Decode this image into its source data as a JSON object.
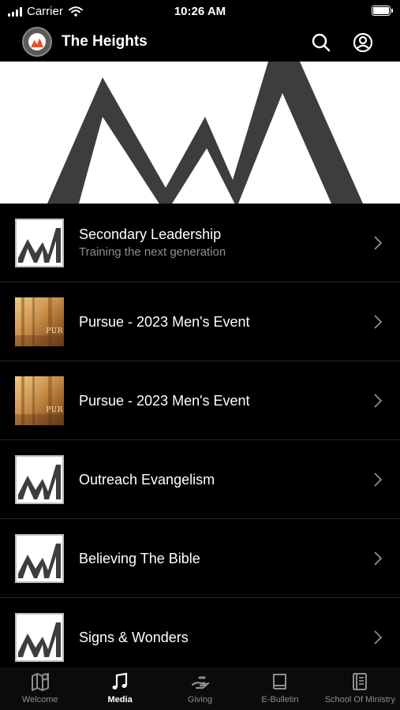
{
  "status_bar": {
    "carrier": "Carrier",
    "time": "10:26 AM"
  },
  "nav": {
    "title": "The Heights"
  },
  "list": {
    "items": [
      {
        "title": "Secondary Leadership",
        "subtitle": "Training the next generation",
        "thumbnail": "heights-logo"
      },
      {
        "title": "Pursue - 2023 Men's Event",
        "subtitle": "",
        "thumbnail": "pursue-photo",
        "thumb_text": "PUR"
      },
      {
        "title": "Pursue - 2023 Men's Event",
        "subtitle": "",
        "thumbnail": "pursue-photo",
        "thumb_text": "PUR"
      },
      {
        "title": "Outreach Evangelism",
        "subtitle": "",
        "thumbnail": "heights-logo"
      },
      {
        "title": "Believing The Bible",
        "subtitle": "",
        "thumbnail": "heights-logo"
      },
      {
        "title": "Signs & Wonders",
        "subtitle": "",
        "thumbnail": "heights-logo"
      }
    ]
  },
  "tabs": [
    {
      "label": "Welcome",
      "icon": "map-pin-icon",
      "active": false
    },
    {
      "label": "Media",
      "icon": "music-note-icon",
      "active": true
    },
    {
      "label": "Giving",
      "icon": "giving-hand-icon",
      "active": false
    },
    {
      "label": "E-Bulletin",
      "icon": "book-icon",
      "active": false
    },
    {
      "label": "School Of Ministry",
      "icon": "notebook-icon",
      "active": false
    }
  ],
  "colors": {
    "background": "#000000",
    "active_tab": "#ffffff",
    "inactive_tab": "#8e8e93",
    "subtitle": "#8e8e93",
    "logo_gray": "#3d3d3d"
  }
}
